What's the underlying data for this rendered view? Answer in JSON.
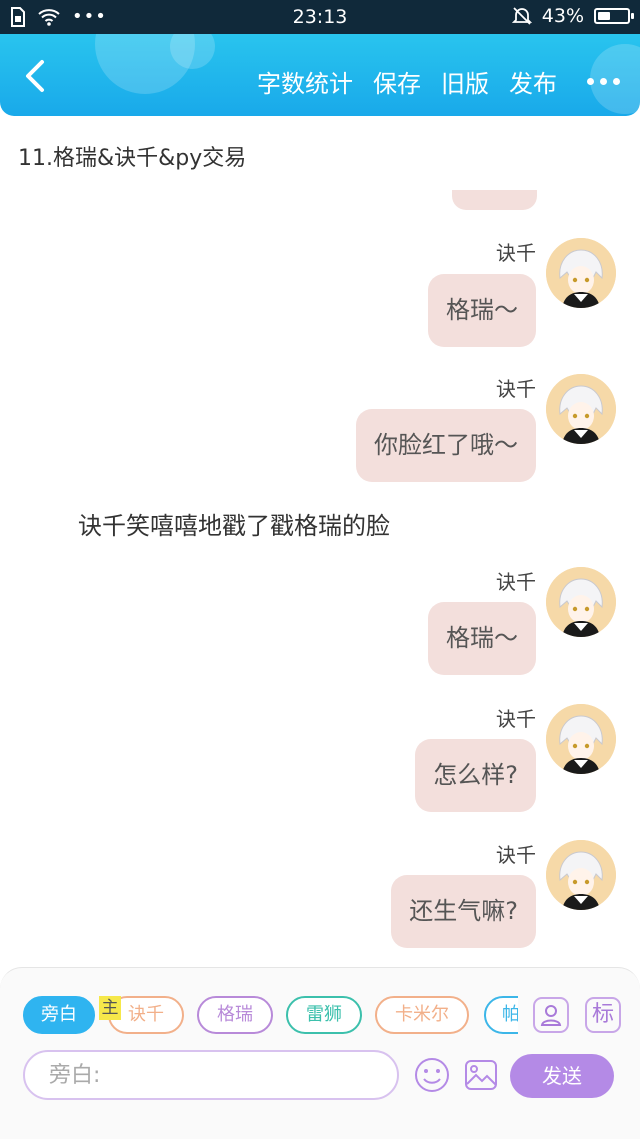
{
  "status_bar": {
    "time": "23:13",
    "battery_text": "43%",
    "battery_level": 0.43,
    "icons": [
      "sim-icon",
      "wifi-icon",
      "more-dots-icon",
      "bell-muted-icon",
      "battery-icon"
    ]
  },
  "toolbar": {
    "back_icon": "chevron-left-icon",
    "word_count": "字数统计",
    "save": "保存",
    "old_version": "旧版",
    "publish": "发布",
    "more_icon": "more-horizontal-icon"
  },
  "document": {
    "title": "11.格瑞&诀千&py交易"
  },
  "messages": [
    {
      "type": "character",
      "name": "诀千",
      "text": "格瑞～"
    },
    {
      "type": "character",
      "name": "诀千",
      "text": "你脸红了哦～"
    },
    {
      "type": "narration",
      "text": "诀千笑嘻嘻地戳了戳格瑞的脸"
    },
    {
      "type": "character",
      "name": "诀千",
      "text": "格瑞～"
    },
    {
      "type": "character",
      "name": "诀千",
      "text": "怎么样?"
    },
    {
      "type": "character",
      "name": "诀千",
      "text": "还生气嘛?"
    }
  ],
  "composer": {
    "main_badge": "主",
    "roles": [
      {
        "label": "旁白",
        "color": "#2fb4f0",
        "active": true
      },
      {
        "label": "诀千",
        "color": "#f2b08a",
        "active": false
      },
      {
        "label": "格瑞",
        "color": "#b88ad9",
        "active": false
      },
      {
        "label": "雷狮",
        "color": "#3cc0ac",
        "active": false
      },
      {
        "label": "卡米尔",
        "color": "#f2b08a",
        "active": false
      },
      {
        "label": "帕",
        "color": "#3cb6e8",
        "active": false
      }
    ],
    "role_tool_icon": "person-card-icon",
    "tag_tool_label": "标",
    "input_placeholder": "旁白:",
    "emoji_icon": "smiley-icon",
    "image_icon": "image-icon",
    "send_label": "发送"
  },
  "colors": {
    "appbar": "#19a9ea",
    "bubble": "#f3dfdc",
    "send": "#b48ae6",
    "active_chip": "#2fb4f0"
  }
}
